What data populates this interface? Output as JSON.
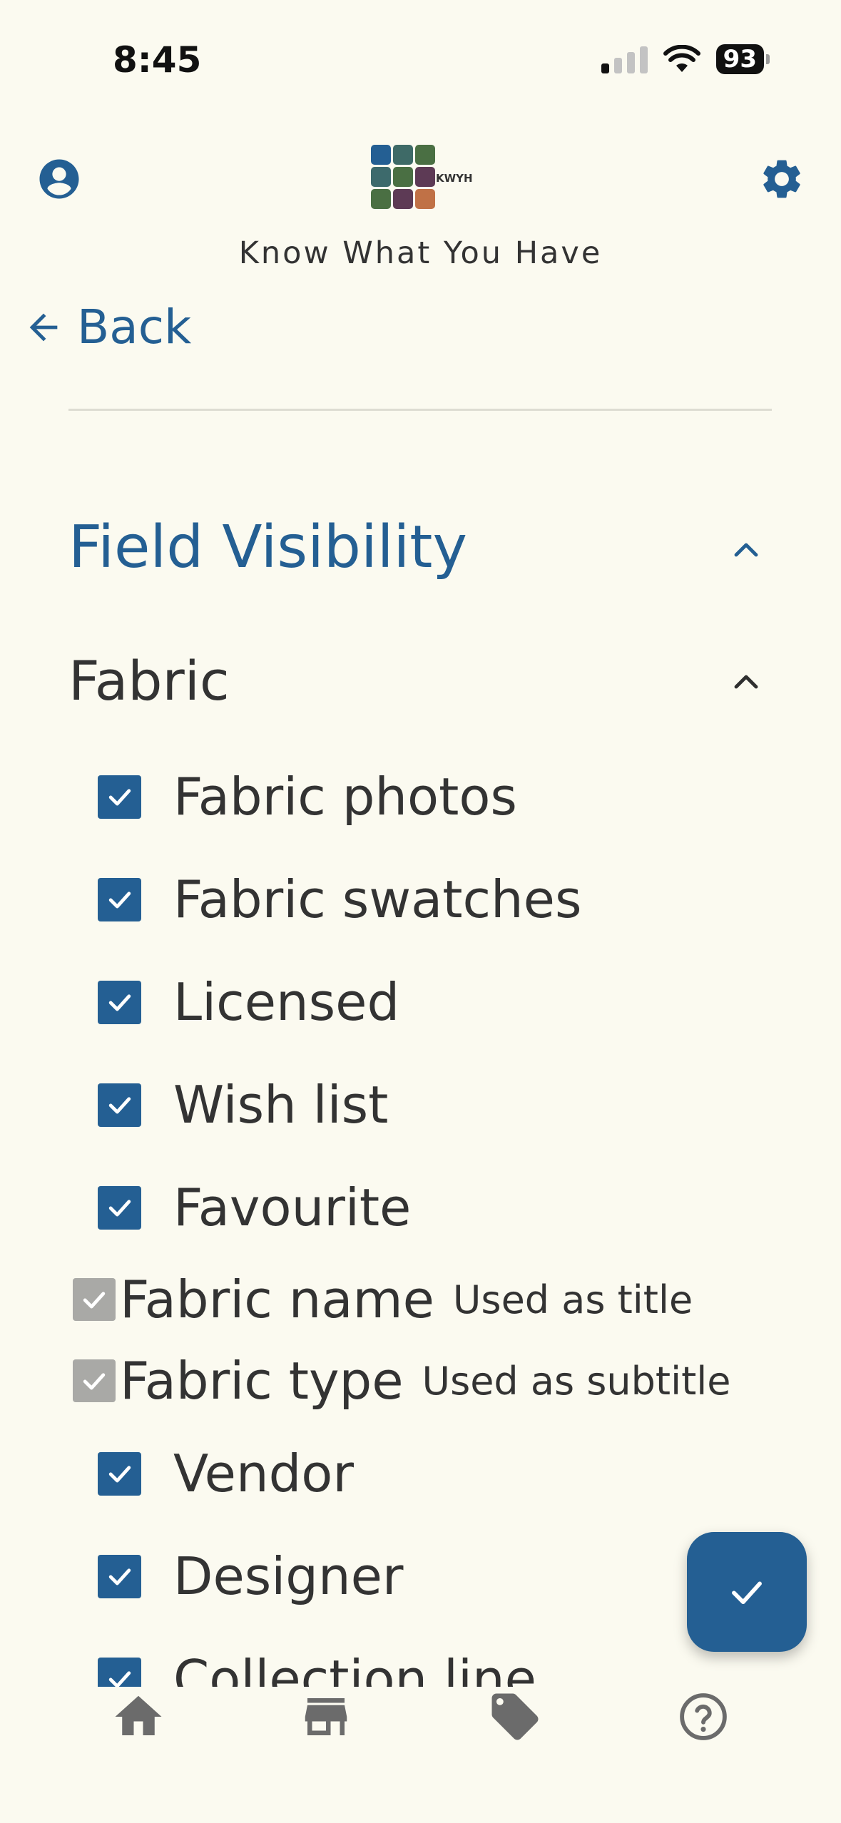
{
  "status_bar": {
    "time": "8:45",
    "battery": "93"
  },
  "header": {
    "logo_text": "KWYH",
    "tagline": "Know What You Have",
    "logo_colors": [
      "#245f93",
      "#3e6a67",
      "#4a6f43",
      "#3d6a6c",
      "#4a6f43",
      "#5d3a55",
      "#4a6f43",
      "#5d3a55",
      "#c07146"
    ]
  },
  "nav": {
    "back_label": "Back"
  },
  "section": {
    "title": "Field Visibility",
    "subsection_title": "Fabric"
  },
  "fields": [
    {
      "label": "Fabric photos",
      "checked": true
    },
    {
      "label": "Fabric swatches",
      "checked": true
    },
    {
      "label": "Licensed",
      "checked": true
    },
    {
      "label": "Wish list",
      "checked": true
    },
    {
      "label": "Favourite",
      "checked": true
    }
  ],
  "fixed_fields": [
    {
      "label": "Fabric name",
      "note": "Used as title"
    },
    {
      "label": "Fabric type",
      "note": "Used as subtitle"
    }
  ],
  "more_fields": [
    {
      "label": "Vendor",
      "checked": true
    },
    {
      "label": "Designer",
      "checked": true
    },
    {
      "label": "Collection line",
      "checked": true
    }
  ],
  "bottom_nav": {
    "items": [
      "home-icon",
      "store-icon",
      "tag-icon",
      "help-icon"
    ]
  },
  "colors": {
    "accent": "#245f93",
    "background": "#fbfaf0",
    "nav_icon": "#6b6b6b",
    "disabled_checkbox": "#a9a9a6"
  }
}
